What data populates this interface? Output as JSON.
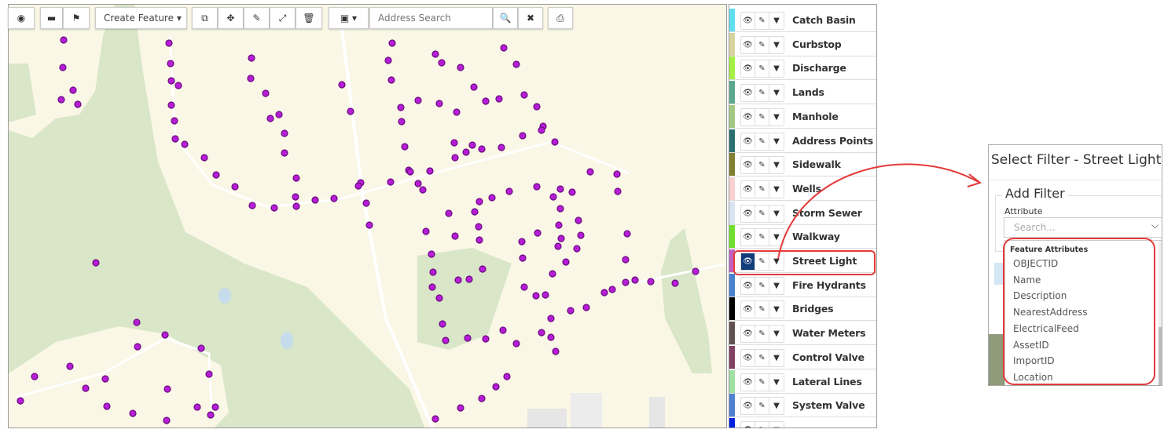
{
  "toolbar": {
    "create_feature": "Create Feature ▾",
    "search_placeholder": "Address Search",
    "icons": [
      "identify-icon",
      "measure-icon",
      "bookmark-icon",
      "copy-icon",
      "move-icon",
      "edit-icon",
      "resize-icon",
      "trash-icon",
      "basemap-icon",
      "search-icon",
      "close-icon",
      "print-icon"
    ]
  },
  "layers": [
    {
      "name": "Catch Basin",
      "color": "#5ee0ee"
    },
    {
      "name": "Curbstop",
      "color": "#d8d4a0"
    },
    {
      "name": "Discharge",
      "color": "#a4f044"
    },
    {
      "name": "Lands",
      "color": "#5aa890"
    },
    {
      "name": "Manhole",
      "color": "#a2c884"
    },
    {
      "name": "Address Points",
      "color": "#2a7070"
    },
    {
      "name": "Sidewalk",
      "color": "#808030"
    },
    {
      "name": "Wells",
      "color": "#f8d0d0"
    },
    {
      "name": "Storm Sewer",
      "color": "#d8e4f2"
    },
    {
      "name": "Walkway",
      "color": "#70e030"
    },
    {
      "name": "Street Light",
      "color": "#c060c0",
      "active": true
    },
    {
      "name": "Fire Hydrants",
      "color": "#4a80d0"
    },
    {
      "name": "Bridges",
      "color": "#000000"
    },
    {
      "name": "Water Meters",
      "color": "#605050"
    },
    {
      "name": "Control Valve",
      "color": "#804060"
    },
    {
      "name": "Lateral Lines",
      "color": "#a0e0a0"
    },
    {
      "name": "System Valve",
      "color": "#5080d0"
    },
    {
      "name": "",
      "color": "#0020e0"
    }
  ],
  "filter_dialog": {
    "title": "Select Filter - Street Light",
    "section": "Add Filter",
    "attribute_label": "Attribute",
    "search_placeholder": "Search...",
    "group_header": "Feature Attributes",
    "options": [
      "OBJECTID",
      "Name",
      "Description",
      "NearestAddress",
      "ElectricalFeed",
      "AssetID",
      "ImportID",
      "Location"
    ]
  },
  "colors": {
    "point": "#b61ed6",
    "highlight": "#e53a3a",
    "active_button": "#123c7a"
  }
}
